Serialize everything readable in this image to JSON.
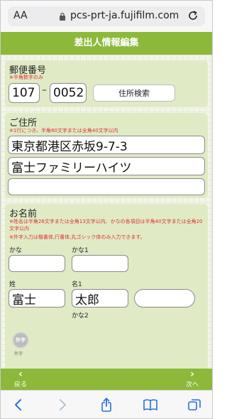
{
  "browser": {
    "aa_label": "AA",
    "url": "pcs-prt-ja.fujifilm.com"
  },
  "header": {
    "title": "差出人情報編集"
  },
  "postal": {
    "label": "郵便番号",
    "note": "※半角数字のみ",
    "part1": "107",
    "dash": "–",
    "part2": "0052",
    "search_button": "住所検索"
  },
  "address": {
    "label": "ご住所",
    "note": "※1行につき、半角80文字または全角40文字以内",
    "line1": "東京都港区赤坂9-7-3",
    "line2": "富士ファミリーハイツ",
    "line3": ""
  },
  "name": {
    "label": "お名前",
    "note1": "※姓名は半角26文字または全角13文字以内、かなの各項目は半角40文字または全角20文字以内",
    "note2": "※外字入力は楷書体,行書体,丸ゴシック体のみ入力できます。",
    "kana_label": "かな",
    "kana1_label": "かな1",
    "kana_value": "",
    "kana1_value": "",
    "sei_label": "姓",
    "mei1_label": "名1",
    "sei_value": "富士",
    "mei1_value": "太郎",
    "extra_value": "",
    "kana2_label": "かな2"
  },
  "gaiji": {
    "badge": "外字",
    "sub": "外字"
  },
  "bottom_nav": {
    "back": "戻る",
    "next": "次へ"
  },
  "colors": {
    "accent": "#8cb93a",
    "card": "#e0ebc6",
    "note": "#e03030"
  }
}
